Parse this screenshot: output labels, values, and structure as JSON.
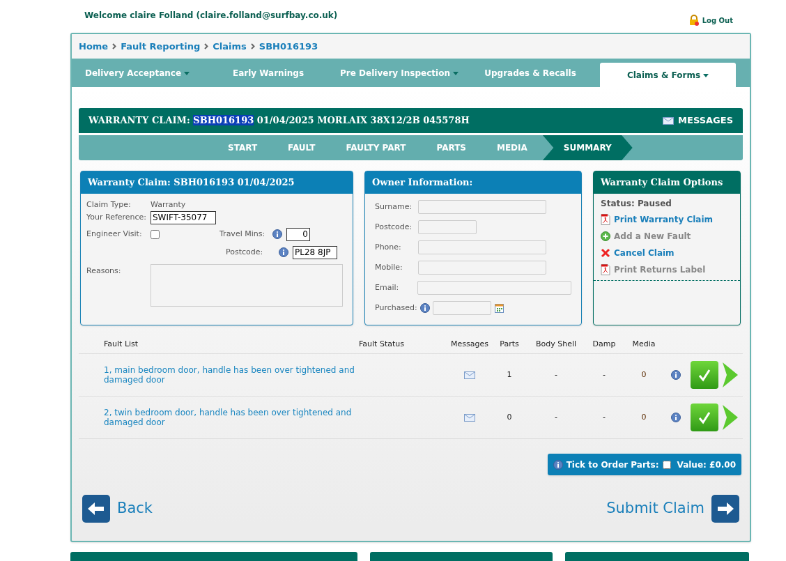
{
  "header": {
    "welcome": "Welcome claire Folland (claire.folland@surfbay.co.uk)",
    "logout": "Log Out"
  },
  "breadcrumbs": [
    "Home",
    "Fault Reporting",
    "Claims",
    "SBH016193"
  ],
  "nav_tabs": [
    {
      "label": "Delivery Acceptance",
      "dropdown": true,
      "selected": false
    },
    {
      "label": "Early Warnings",
      "dropdown": false,
      "selected": false
    },
    {
      "label": "Pre Delivery Inspection",
      "dropdown": true,
      "selected": false
    },
    {
      "label": "Upgrades & Recalls",
      "dropdown": false,
      "selected": false
    },
    {
      "label": "Claims & Forms",
      "dropdown": true,
      "selected": true
    }
  ],
  "claim_header": {
    "prefix": "WARRANTY CLAIM:",
    "highlighted": "SBH016193",
    "rest": "01/04/2025 MORLAIX 38X12/2B 045578H",
    "messages": "MESSAGES"
  },
  "steps": [
    {
      "label": "START",
      "selected": false
    },
    {
      "label": "FAULT",
      "selected": false
    },
    {
      "label": "FAULTY PART",
      "selected": false
    },
    {
      "label": "PARTS",
      "selected": false
    },
    {
      "label": "MEDIA",
      "selected": false
    },
    {
      "label": "SUMMARY",
      "selected": true
    }
  ],
  "claim_panel": {
    "title": "Warranty Claim: SBH016193 01/04/2025",
    "claim_type_label": "Claim Type:",
    "claim_type": "Warranty",
    "reference_label": "Your Reference:",
    "reference": "SWIFT-35077",
    "engineer_label": "Engineer Visit:",
    "engineer_visit": false,
    "travel_label": "Travel Mins:",
    "travel_mins": "0",
    "postcode_label": "Postcode:",
    "postcode": "PL28 8JP",
    "reasons_label": "Reasons:"
  },
  "owner_panel": {
    "title": "Owner Information:",
    "fields": [
      {
        "label": "Surname:",
        "kind": "wide"
      },
      {
        "label": "Postcode:",
        "kind": "short"
      },
      {
        "label": "Phone:",
        "kind": "wide"
      },
      {
        "label": "Mobile:",
        "kind": "wide"
      },
      {
        "label": "Email:",
        "kind": "email"
      },
      {
        "label": "Purchased:",
        "kind": "date"
      }
    ]
  },
  "options_panel": {
    "title": "Warranty Claim Options",
    "status": "Status: Paused",
    "items": [
      {
        "label": "Print Warranty Claim",
        "kind": "pdf",
        "disabled": false
      },
      {
        "label": "Add a New Fault",
        "kind": "add",
        "disabled": true
      },
      {
        "label": "Cancel Claim",
        "kind": "cancel",
        "disabled": false
      },
      {
        "label": "Print Returns Label",
        "kind": "pdf",
        "disabled": true
      }
    ]
  },
  "fault_table": {
    "columns": [
      "Fault List",
      "Fault Status",
      "Messages",
      "Parts",
      "Body Shell",
      "Damp",
      "Media"
    ],
    "rows": [
      {
        "description": "1, main bedroom door, handle has been over tightened and damaged door",
        "parts": "1",
        "body_shell": "-",
        "damp": "-",
        "media": "0"
      },
      {
        "description": "2, twin bedroom door, handle has been over tightened and damaged door",
        "parts": "0",
        "body_shell": "-",
        "damp": "-",
        "media": "0"
      }
    ]
  },
  "order_parts": {
    "label": "Tick to Order Parts:",
    "checked": false,
    "value": "Value: £0.00"
  },
  "footer_buttons": {
    "back": "Back",
    "submit": "Submit Claim"
  }
}
